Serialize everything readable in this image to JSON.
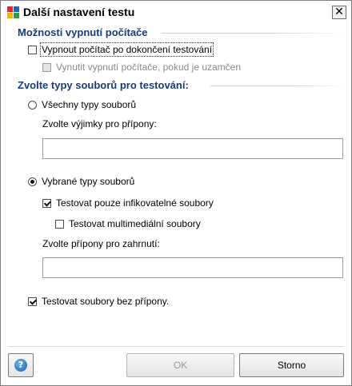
{
  "window": {
    "title": "Další nastavení testu",
    "close_glyph": "✕"
  },
  "shutdown": {
    "heading": "Možnosti vypnutí počítače",
    "option_shutdown": {
      "label": "Vypnout počítač po dokončení testování",
      "checked": false
    },
    "option_force": {
      "label": "Vynutit vypnutí počítače, pokud je uzamčen",
      "checked": false,
      "disabled": true
    }
  },
  "file_types": {
    "heading": "Zvolte typy souborů pro testování:",
    "all_types": {
      "label": "Všechny typy souborů",
      "selected": false
    },
    "exclusions_label": "Zvolte výjimky pro přípony:",
    "exclusions_value": "",
    "selected_types": {
      "label": "Vybrané typy souborů",
      "selected": true
    },
    "infectable_only": {
      "label": "Testovat pouze infikovatelné soubory",
      "checked": true
    },
    "multimedia": {
      "label": "Testovat multimediální soubory",
      "checked": false
    },
    "inclusions_label": "Zvolte přípony pro zahrnutí:",
    "inclusions_value": "",
    "no_extension": {
      "label": "Testovat soubory bez přípony.",
      "checked": true
    }
  },
  "footer": {
    "help_glyph": "?",
    "ok_label": "OK",
    "cancel_label": "Storno"
  },
  "colors": {
    "heading": "#1a3a7a",
    "separator": "#c7d0e4"
  },
  "icons": {
    "app": "avg-logo-icon",
    "close": "close-icon",
    "help": "help-icon"
  }
}
